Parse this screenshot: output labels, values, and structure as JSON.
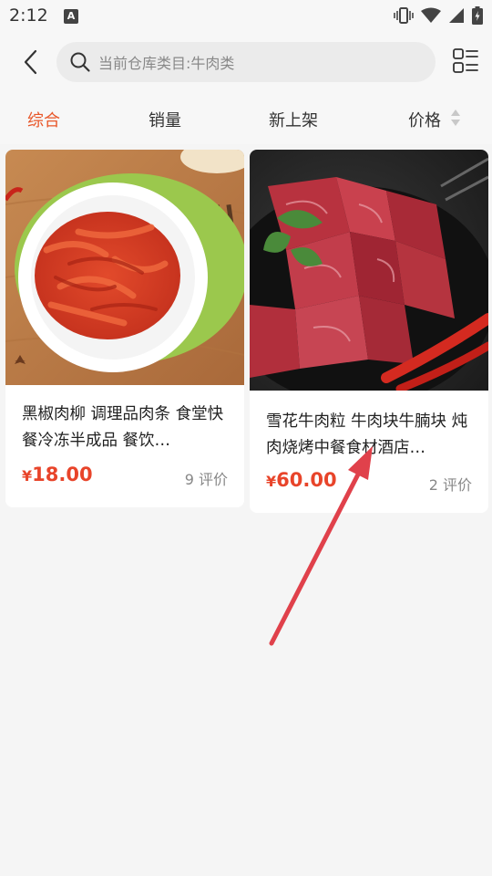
{
  "status_bar": {
    "time": "2:12",
    "notification_badge": "A"
  },
  "header": {
    "search_placeholder": "当前仓库类目:牛肉类"
  },
  "sort_bar": {
    "items": [
      {
        "label": "综合",
        "active": true
      },
      {
        "label": "销量",
        "active": false
      },
      {
        "label": "新上架",
        "active": false
      },
      {
        "label": "价格",
        "active": false
      }
    ]
  },
  "products": [
    {
      "title": "黑椒肉柳 调理品肉条 食堂快餐冷冻半成品 餐饮…",
      "currency": "¥",
      "price": "18.00",
      "reviews": "9 评价",
      "image": "marinated-meat-strips-plate"
    },
    {
      "title": "雪花牛肉粒 牛肉块牛腩块 炖肉烧烤中餐食材酒店…",
      "currency": "¥",
      "price": "60.00",
      "reviews": "2 评价",
      "image": "raw-beef-cubes-with-chili"
    }
  ],
  "colors": {
    "accent": "#e8572a",
    "price": "#e8442a",
    "annotation_arrow": "#e0414b"
  }
}
